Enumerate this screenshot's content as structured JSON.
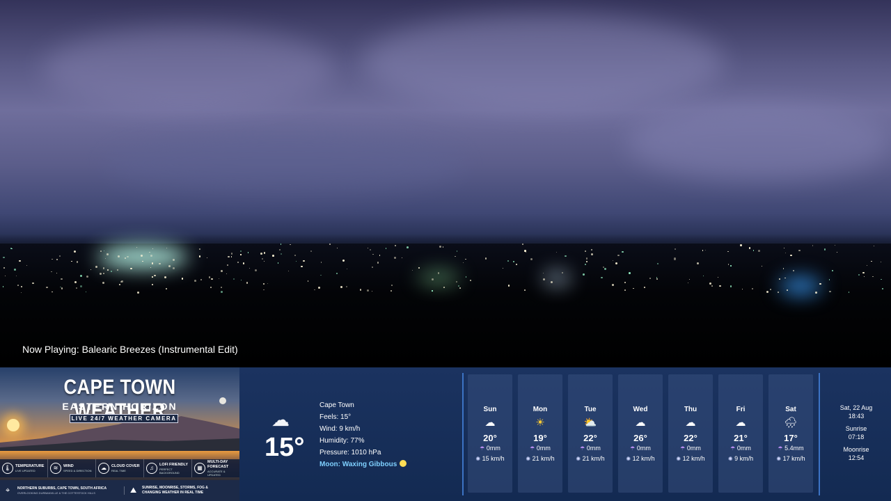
{
  "now_playing": "Now Playing: Balearic Breezes (Instrumental Edit)",
  "brand": {
    "title": "CAPE TOWN WEATHER",
    "subtitle": "EASTERN HORIZON",
    "tagline": "LIVE 24/7 WEATHER CAMERA",
    "features": [
      {
        "icon": "thermometer-icon",
        "glyph": "🌡",
        "title": "TEMPERATURE",
        "sub": "LIVE UPDATED"
      },
      {
        "icon": "wind-icon",
        "glyph": "≋",
        "title": "WIND",
        "sub": "SPEED & DIRECTION"
      },
      {
        "icon": "cloud-icon",
        "glyph": "☁",
        "title": "CLOUD COVER",
        "sub": "REAL TIME"
      },
      {
        "icon": "headphones-icon",
        "glyph": "♫",
        "title": "LOFI FRIENDLY",
        "sub": "PERFECT BACKGROUND"
      },
      {
        "icon": "calendar-icon",
        "glyph": "▦",
        "title": "MULTI-DAY FORECAST",
        "sub": "ACCURATE & UPDATED"
      }
    ],
    "location_title": "NORTHERN SUBURBS, CAPE TOWN, SOUTH AFRICA",
    "location_sub": "OVERLOOKING DURBANVILLE & THE COTTESTOCK HILLS",
    "location_desc_line1": "SUNRISE, MOONRISE, STORMS, FOG &",
    "location_desc_line2": "CHANGING WEATHER IN REAL TIME"
  },
  "current": {
    "icon": "cloud-icon",
    "temp": "15°",
    "city": "Cape Town",
    "feels": "Feels: 15°",
    "wind": "Wind: 9 km/h",
    "humidity": "Humidity: 77%",
    "pressure": "Pressure: 1010 hPa",
    "moon": "Moon: Waxing Gibbous"
  },
  "forecast": [
    {
      "day": "Sun",
      "icon": "cloud-icon",
      "glyph": "☁",
      "temp": "20°",
      "rain": "0mm",
      "wind": "15 km/h"
    },
    {
      "day": "Mon",
      "icon": "sun-icon",
      "glyph": "☀",
      "temp": "19°",
      "rain": "0mm",
      "wind": "21 km/h"
    },
    {
      "day": "Tue",
      "icon": "partly-cloudy-icon",
      "glyph": "⛅",
      "temp": "22°",
      "rain": "0mm",
      "wind": "21 km/h"
    },
    {
      "day": "Wed",
      "icon": "cloud-icon",
      "glyph": "☁",
      "temp": "26°",
      "rain": "0mm",
      "wind": "12 km/h"
    },
    {
      "day": "Thu",
      "icon": "cloud-icon",
      "glyph": "☁",
      "temp": "22°",
      "rain": "0mm",
      "wind": "12 km/h"
    },
    {
      "day": "Fri",
      "icon": "cloud-icon",
      "glyph": "☁",
      "temp": "21°",
      "rain": "0mm",
      "wind": "9 km/h"
    },
    {
      "day": "Sat",
      "icon": "rain-cloud-icon",
      "glyph": "🌧",
      "temp": "17°",
      "rain": "5.4mm",
      "wind": "17 km/h"
    }
  ],
  "side": {
    "date": "Sat, 22 Aug",
    "time": "18:43",
    "sunrise_label": "Sunrise",
    "sunrise": "07:18",
    "moonrise_label": "Moonrise",
    "moonrise": "12:54"
  }
}
